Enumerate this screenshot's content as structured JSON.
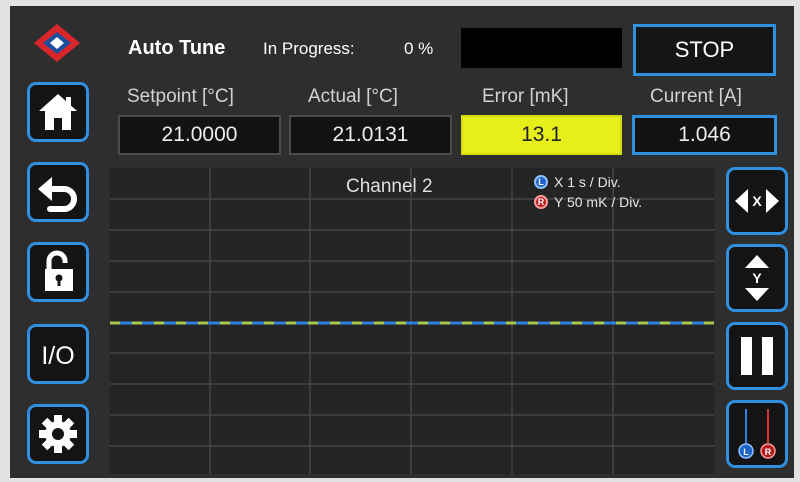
{
  "header": {
    "title": "Auto Tune",
    "progress_label": "In Progress:",
    "progress_value": "0 %",
    "stop_label": "STOP"
  },
  "readouts": [
    {
      "label": "Setpoint [°C]",
      "value": "21.0000"
    },
    {
      "label": "Actual [°C]",
      "value": "21.0131"
    },
    {
      "label": "Error [mK]",
      "value": "13.1"
    },
    {
      "label": "Current [A]",
      "value": "1.046"
    }
  ],
  "graph": {
    "channel": "Channel 2",
    "x_legend": {
      "marker": "L",
      "text": "X  1 s / Div."
    },
    "y_legend": {
      "marker": "R",
      "text": "Y  50 mK / Div."
    },
    "trace_colors": [
      "#2e7fe0",
      "#a9c84a"
    ]
  },
  "sidebar": {
    "icons": [
      "logo-icon",
      "home-icon",
      "back-icon",
      "unlock-icon",
      "io-icon",
      "gear-icon"
    ],
    "io_label": "I/O"
  },
  "controls": {
    "icons": [
      "x-scale-icon",
      "y-scale-icon",
      "pause-icon",
      "channel-select-icon"
    ],
    "x_label": "X",
    "y_label": "Y",
    "left_label": "L",
    "right_label": "R"
  },
  "colors": {
    "accent": "#2f8fe0",
    "error_highlight": "#e6ef1a",
    "background": "#2e2e2e"
  }
}
